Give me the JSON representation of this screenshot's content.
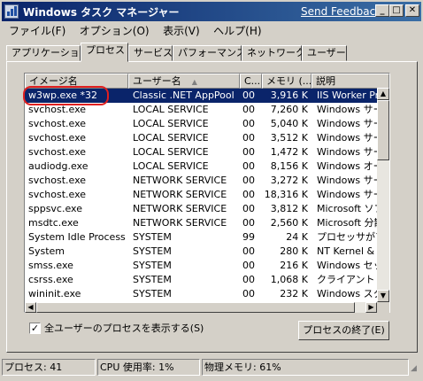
{
  "window": {
    "title": "Windows タスク マネージャー",
    "feedback_link": "Send Feedback",
    "minimize": "_",
    "maximize": "□",
    "close": "✕"
  },
  "menu": [
    "ファイル(F)",
    "オプション(O)",
    "表示(V)",
    "ヘルプ(H)"
  ],
  "tabs": [
    "アプリケーション",
    "プロセス",
    "サービス",
    "パフォーマンス",
    "ネットワーク",
    "ユーザー"
  ],
  "active_tab": "プロセス",
  "columns": [
    "イメージ名",
    "ユーザー名",
    "C...",
    "メモリ (...",
    "説明"
  ],
  "processes": [
    {
      "name": "w3wp.exe *32",
      "user": "Classic .NET AppPool",
      "cpu": "00",
      "mem": "3,916 K",
      "desc": "IIS Worker Proc",
      "selected": true
    },
    {
      "name": "svchost.exe",
      "user": "LOCAL SERVICE",
      "cpu": "00",
      "mem": "7,260 K",
      "desc": "Windows サービ"
    },
    {
      "name": "svchost.exe",
      "user": "LOCAL SERVICE",
      "cpu": "00",
      "mem": "5,040 K",
      "desc": "Windows サービ"
    },
    {
      "name": "svchost.exe",
      "user": "LOCAL SERVICE",
      "cpu": "00",
      "mem": "3,512 K",
      "desc": "Windows サービ"
    },
    {
      "name": "svchost.exe",
      "user": "LOCAL SERVICE",
      "cpu": "00",
      "mem": "1,472 K",
      "desc": "Windows サービ"
    },
    {
      "name": "audiodg.exe",
      "user": "LOCAL SERVICE",
      "cpu": "00",
      "mem": "8,156 K",
      "desc": "Windows オーデ"
    },
    {
      "name": "svchost.exe",
      "user": "NETWORK SERVICE",
      "cpu": "00",
      "mem": "3,272 K",
      "desc": "Windows サービ"
    },
    {
      "name": "svchost.exe",
      "user": "NETWORK SERVICE",
      "cpu": "00",
      "mem": "18,316 K",
      "desc": "Windows サービ"
    },
    {
      "name": "sppsvc.exe",
      "user": "NETWORK SERVICE",
      "cpu": "00",
      "mem": "3,812 K",
      "desc": "Microsoft ソフト"
    },
    {
      "name": "msdtc.exe",
      "user": "NETWORK SERVICE",
      "cpu": "00",
      "mem": "2,560 K",
      "desc": "Microsoft 分散"
    },
    {
      "name": "System Idle Process",
      "user": "SYSTEM",
      "cpu": "99",
      "mem": "24 K",
      "desc": "プロセッサがアイド"
    },
    {
      "name": "System",
      "user": "SYSTEM",
      "cpu": "00",
      "mem": "280 K",
      "desc": "NT Kernel & Sy"
    },
    {
      "name": "smss.exe",
      "user": "SYSTEM",
      "cpu": "00",
      "mem": "216 K",
      "desc": "Windows セッショ"
    },
    {
      "name": "csrss.exe",
      "user": "SYSTEM",
      "cpu": "00",
      "mem": "1,068 K",
      "desc": "クライアント サー"
    },
    {
      "name": "wininit.exe",
      "user": "SYSTEM",
      "cpu": "00",
      "mem": "232 K",
      "desc": "Windows スター"
    }
  ],
  "show_all_users_label": "全ユーザーのプロセスを表示する(S)",
  "show_all_users_checked": true,
  "end_process_button": "プロセスの終了(E)",
  "status": {
    "processes": "プロセス: 41",
    "cpu": "CPU 使用率: 1%",
    "memory": "物理メモリ: 61%"
  },
  "colors": {
    "title_gradient_start": "#0a246a",
    "title_gradient_end": "#3a6ea5",
    "selection": "#0a246a",
    "face": "#d4d0c8",
    "annotation": "#e02020"
  }
}
